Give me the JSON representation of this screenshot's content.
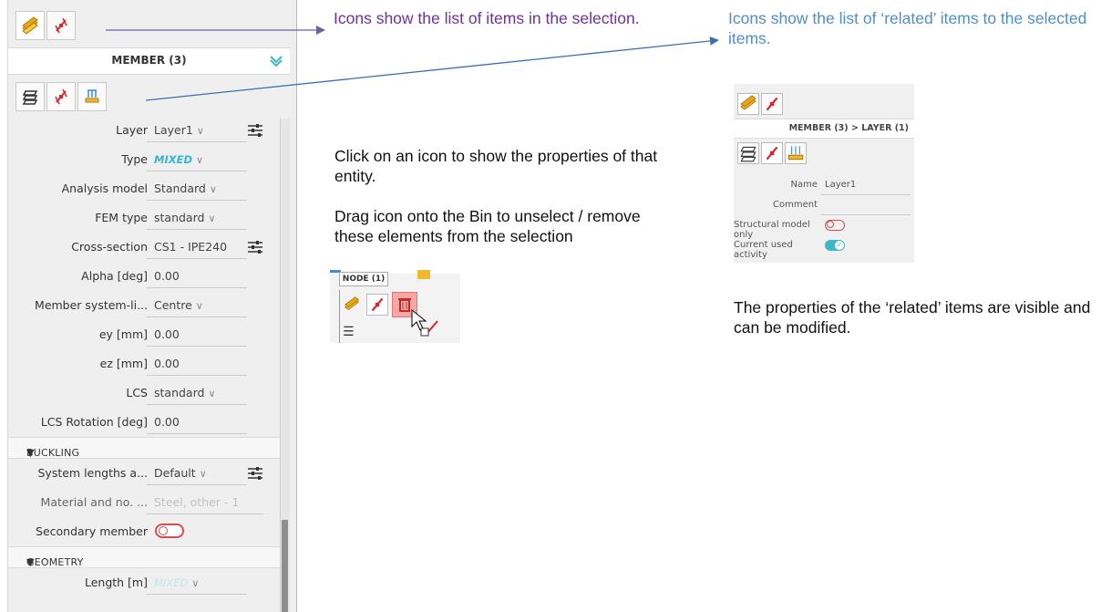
{
  "panel": {
    "selection_title": "MEMBER (3)",
    "rows": [
      {
        "label": "Layer",
        "value": "Layer1"
      },
      {
        "label": "Type",
        "value": "MIXED"
      },
      {
        "label": "Analysis model",
        "value": "Standard"
      },
      {
        "label": "FEM type",
        "value": "standard"
      },
      {
        "label": "Cross-section",
        "value": "CS1 - IPE240"
      },
      {
        "label": "Alpha [deg]",
        "value": "0.00"
      },
      {
        "label": "Member system-li...",
        "value": "Centre"
      },
      {
        "label": "ey [mm]",
        "value": "0.00"
      },
      {
        "label": "ez [mm]",
        "value": "0.00"
      },
      {
        "label": "LCS",
        "value": "standard"
      },
      {
        "label": "LCS Rotation [deg]",
        "value": "0.00"
      }
    ],
    "buckling": {
      "title": "BUCKLING",
      "rows": [
        {
          "label": "System lengths a...",
          "value": "Default"
        },
        {
          "label": "Material and no. ...",
          "value": "Steel, other - 1"
        },
        {
          "label": "Secondary member",
          "value": ""
        }
      ]
    },
    "geometry": {
      "title": "GEOMETRY",
      "rows": [
        {
          "label": "Length [m]",
          "value": "MIXED"
        }
      ]
    }
  },
  "annotations": {
    "selection_icons": "Icons show the list of items in the selection.",
    "related_icons": "Icons show the list of ‘related’ items to the selected items.",
    "click_icon": "Click on an icon to show the properties of that entity.",
    "drag_icon": "Drag icon onto the Bin to unselect / remove these elements from the selection",
    "related_props": "The properties of the ‘related’ items are visible and can be modified."
  },
  "drag_shot": {
    "tooltip": "NODE (1)"
  },
  "related_shot": {
    "title": "MEMBER (3) > LAYER (1)",
    "rows": [
      {
        "label": "Name",
        "value": "Layer1"
      },
      {
        "label": "Comment",
        "value": ""
      },
      {
        "label": "Structural model only",
        "value": ""
      },
      {
        "label": "Current used activity",
        "value": ""
      }
    ]
  },
  "icons": {
    "members": "member-stack-icon",
    "node": "node-icon",
    "layers": "layers-icon",
    "load": "load-panel-icon",
    "bin": "bin-icon",
    "tune": "sliders-icon",
    "collapse": "chevron-down-icon"
  },
  "colors": {
    "annotation_purple": "#7030a0",
    "annotation_blue": "#4f8fce",
    "mixed_value": "#36b6d6",
    "toggle_off": "#d84e4e",
    "toggle_on": "#3cb8c8"
  }
}
